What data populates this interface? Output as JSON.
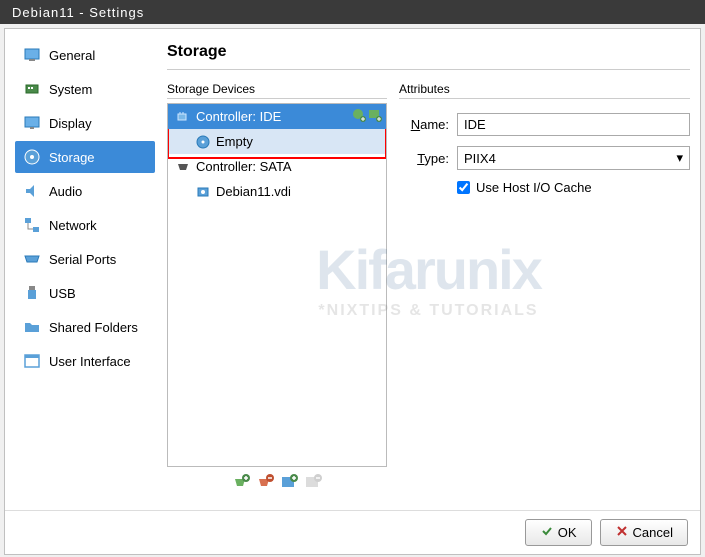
{
  "window": {
    "title": "Debian11 - Settings"
  },
  "sidebar": {
    "items": [
      {
        "label": "General",
        "icon": "general"
      },
      {
        "label": "System",
        "icon": "system"
      },
      {
        "label": "Display",
        "icon": "display"
      },
      {
        "label": "Storage",
        "icon": "storage",
        "active": true
      },
      {
        "label": "Audio",
        "icon": "audio"
      },
      {
        "label": "Network",
        "icon": "network"
      },
      {
        "label": "Serial Ports",
        "icon": "serial"
      },
      {
        "label": "USB",
        "icon": "usb"
      },
      {
        "label": "Shared Folders",
        "icon": "folder"
      },
      {
        "label": "User Interface",
        "icon": "ui"
      }
    ]
  },
  "page": {
    "title": "Storage"
  },
  "devices": {
    "label": "Storage Devices",
    "tree": [
      {
        "label": "Controller: IDE",
        "type": "controller",
        "selected": true,
        "children": [
          {
            "label": "Empty",
            "type": "disc",
            "highlight": true
          }
        ]
      },
      {
        "label": "Controller: SATA",
        "type": "controller",
        "children": [
          {
            "label": "Debian11.vdi",
            "type": "disk"
          }
        ]
      }
    ]
  },
  "attributes": {
    "label": "Attributes",
    "name_label": "Name:",
    "name_value": "IDE",
    "type_label": "Type:",
    "type_value": "PIIX4",
    "cache_label": "Use Host I/O Cache",
    "cache_checked": true
  },
  "footer": {
    "ok": "OK",
    "cancel": "Cancel"
  },
  "watermark": {
    "main": "Kifarunix",
    "sub": "*NIXTIPS & TUTORIALS"
  }
}
